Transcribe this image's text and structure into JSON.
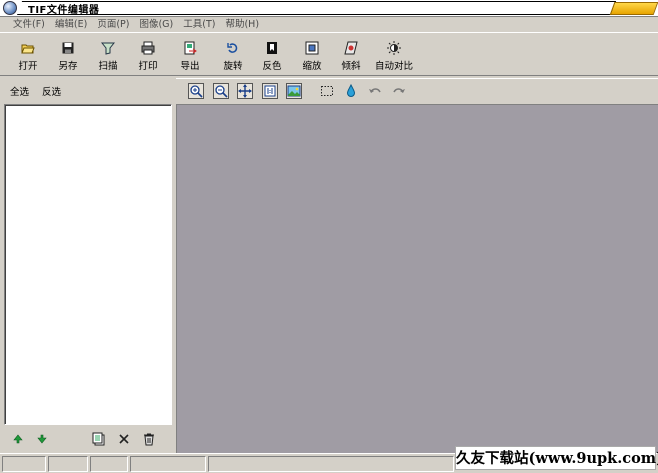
{
  "window": {
    "title": "TIF文件编辑器",
    "corner_badge": ""
  },
  "menu": [
    {
      "label": "文件(F)"
    },
    {
      "label": "编辑(E)"
    },
    {
      "label": "页面(P)"
    },
    {
      "label": "图像(G)"
    },
    {
      "label": "工具(T)"
    },
    {
      "label": "帮助(H)"
    }
  ],
  "toolbar": [
    {
      "label": "打开",
      "icon": "folder-open-icon"
    },
    {
      "label": "另存",
      "icon": "save-icon"
    },
    {
      "label": "扫描",
      "icon": "scan-icon"
    },
    {
      "label": "打印",
      "icon": "printer-icon"
    },
    {
      "label": "导出",
      "icon": "export-icon"
    },
    {
      "label": "旋转",
      "icon": "rotate-icon"
    },
    {
      "label": "反色",
      "icon": "invert-icon"
    },
    {
      "label": "缩放",
      "icon": "resize-icon"
    },
    {
      "label": "倾斜",
      "icon": "skew-icon"
    },
    {
      "label": "自动对比",
      "icon": "auto-contrast-icon"
    }
  ],
  "left_panel": {
    "select_all": "全选",
    "invert_select": "反选"
  },
  "viewer_tools": [
    "zoom-in-icon",
    "zoom-out-icon",
    "fit-page-icon",
    "actual-size-icon",
    "image-icon",
    "selection-rect-icon",
    "dropper-icon",
    "undo-icon",
    "redo-icon"
  ],
  "watermark": "久友下载站(www.9upk.com)",
  "colors": {
    "face": "#d4d0c8",
    "canvas": "#a09ca4",
    "accent": "#1a6fd0"
  }
}
